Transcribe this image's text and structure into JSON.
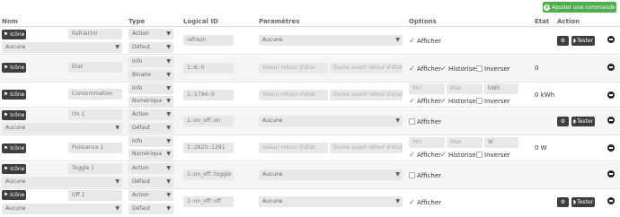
{
  "add_button_label": "Ajouter une commande",
  "headers": {
    "nom": "Nom",
    "type": "Type",
    "logical_id": "Logical ID",
    "parametres": "Paramètres",
    "options": "Options",
    "etat": "Etat",
    "action": "Action"
  },
  "icon_label": "Icône",
  "tester_label": "Tester",
  "afficher_label": "Afficher",
  "historiser_label": "Historiser",
  "inverser_label": "Inverser",
  "ph_valeur_retour": "Valeur retour d'état",
  "ph_duree_avant": "Durée avant retour d'état (m",
  "ph_min": "Min",
  "ph_max": "Max",
  "rows": [
    {
      "name": "Rafraichir",
      "subtype_sel": "Aucune",
      "type": "Action",
      "subtype": "Défaut",
      "logical_id": "refresh",
      "param": "Aucune",
      "state": ""
    },
    {
      "name": "Etat",
      "type": "Info",
      "subtype": "Binaire",
      "logical_id": "1::6::0",
      "state": "0"
    },
    {
      "name": "Consommation",
      "type": "Info",
      "subtype": "Numérique",
      "logical_id": "1::1794::0",
      "unit": "kWh",
      "state": "0 kWh"
    },
    {
      "name": "On 1",
      "subtype_sel": "Aucune",
      "type": "Action",
      "subtype": "Défaut",
      "logical_id": "1::on_off::on",
      "param": "Aucune"
    },
    {
      "name": "Puissance 1",
      "type": "Info",
      "subtype": "Numérique",
      "logical_id": "1::2820::1291",
      "unit": "W",
      "state": "0 W"
    },
    {
      "name": "Toggle 1",
      "subtype_sel": "Aucune",
      "type": "Action",
      "subtype": "Défaut",
      "logical_id": "1::on_off::toggle",
      "param": "Aucune"
    },
    {
      "name": "Off 1",
      "subtype_sel": "Aucune",
      "type": "Action",
      "subtype": "Défaut",
      "logical_id": "1::on_off::off",
      "param": "Aucune"
    }
  ]
}
